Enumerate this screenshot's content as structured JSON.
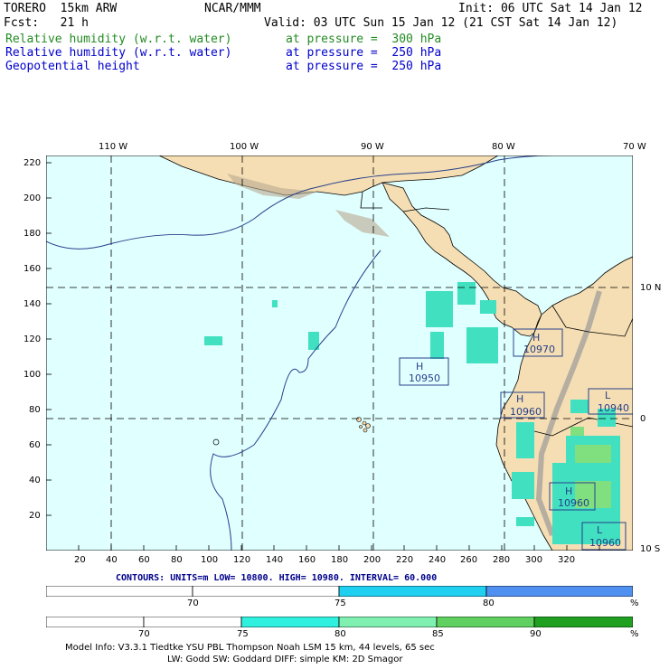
{
  "header": {
    "model": "TORERO  15km ARW",
    "center": "NCAR/MMM",
    "init": "Init: 06 UTC Sat 14 Jan 12",
    "fcst": "Fcst:   21 h",
    "valid": "Valid: 03 UTC Sun 15 Jan 12 (21 CST Sat 14 Jan 12)",
    "fields": [
      {
        "name": "Relative humidity (w.r.t. water)",
        "level": "at pressure =  300 hPa",
        "color": "#228b22"
      },
      {
        "name": "Relative humidity (w.r.t. water)",
        "level": "at pressure =  250 hPa",
        "color": "#0000cd"
      },
      {
        "name": "Geopotential height",
        "level": "at pressure =  250 hPa",
        "color": "#0000cd"
      }
    ]
  },
  "map": {
    "lon_labels": [
      "110 W",
      "100 W",
      "90 W",
      "80 W",
      "70 W"
    ],
    "lat_labels": [
      "10 N",
      "0",
      "10 S"
    ],
    "y_ticks": [
      "220",
      "200",
      "180",
      "160",
      "140",
      "120",
      "100",
      "80",
      "60",
      "40",
      "20"
    ],
    "x_ticks": [
      "20",
      "40",
      "60",
      "80",
      "100",
      "120",
      "140",
      "160",
      "180",
      "200",
      "220",
      "240",
      "260",
      "280",
      "300",
      "320"
    ],
    "centers": [
      {
        "type": "H",
        "value": "10970"
      },
      {
        "type": "H",
        "value": "10950"
      },
      {
        "type": "H",
        "value": "10960"
      },
      {
        "type": "L",
        "value": "10940"
      },
      {
        "type": "H",
        "value": "10960"
      },
      {
        "type": "L",
        "value": "10960"
      }
    ],
    "ocean_color": "#e0ffff",
    "land_color": "#f5deb3"
  },
  "contours_info": "CONTOURS:  UNITS=m  LOW=  10800.       HIGH=  10980.      INTERVAL=   60.000",
  "bar1": {
    "labels": [
      "70",
      "75",
      "80",
      "%"
    ],
    "colors": [
      "#ffffff",
      "#ffffff",
      "#20d0f0",
      "#5090f0"
    ]
  },
  "bar2": {
    "labels": [
      "70",
      "75",
      "80",
      "85",
      "90",
      "%"
    ],
    "colors": [
      "#ffffff",
      "#ffffff",
      "#30f0e0",
      "#80f0b0",
      "#60d060",
      "#20a020"
    ]
  },
  "footer": {
    "line1": "Model Info: V3.3.1   Tiedtke YSU PBL  Thompson    Noah LSM  15 km,   44 levels,   65 sec",
    "line2": "LW: Godd SW: Goddard DIFF: simple KM: 2D Smagor"
  }
}
